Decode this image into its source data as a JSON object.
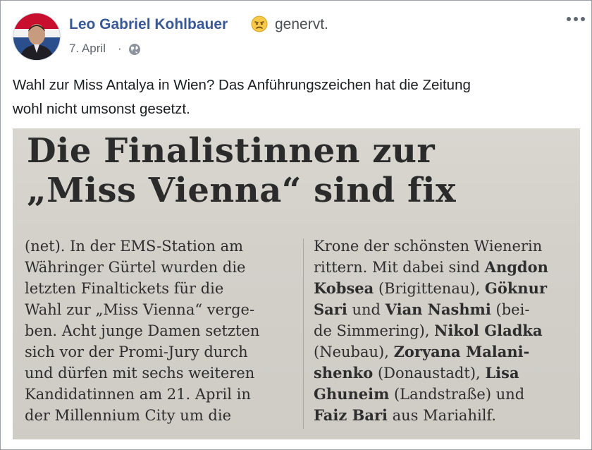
{
  "post": {
    "author": "Leo Gabriel Kohlbauer",
    "feeling": "genervt.",
    "date": "7. April",
    "separator": "·",
    "text_line1": "Wahl zur Miss Antalya in Wien? Das Anführungszeichen hat die Zeitung",
    "text_line2": "wohl nicht umsonst gesetzt."
  },
  "icons": {
    "feeling": "annoyed-emoji-icon",
    "privacy": "globe-icon",
    "menu": "more-options-icon"
  },
  "article": {
    "headline_line1": "Die Finalistinnen zur",
    "headline_line2": "„Miss Vienna“ sind fix",
    "col1": [
      "(net). In der EMS-Station am",
      "Währinger Gürtel wurden die",
      "letzten Finaltickets für die",
      "Wahl zur „Miss Vienna“ verge-",
      "ben. Acht junge Damen setzten",
      "sich vor der Promi-Jury durch",
      "und dürfen mit sechs weiteren",
      "Kandidatinnen am 21. April in",
      "der Millennium City um die"
    ],
    "col2": {
      "l1": "Krone der schönsten Wienerin",
      "l2a": "rittern. Mit dabei sind ",
      "l2b": "Angdon",
      "l3a": "Kobsea",
      "l3b": " (Brigittenau), ",
      "l3c": "Göknur",
      "l4a": "Sari",
      "l4b": " und ",
      "l4c": "Vian Nashmi",
      "l4d": " (bei-",
      "l5a": "de Simmering), ",
      "l5b": "Nikol Gladka",
      "l6a": "(Neubau), ",
      "l6b": "Zoryana Malani-",
      "l7a": "shenko",
      "l7b": " (Donaustadt), ",
      "l7c": "Lisa",
      "l8a": "Ghuneim",
      "l8b": " (Landstraße) und",
      "l9a": "Faiz Bari",
      "l9b": " aus Mariahilf."
    }
  },
  "colors": {
    "author_link": "#385898",
    "secondary_text": "#606770",
    "body_text": "#1c1e21"
  }
}
